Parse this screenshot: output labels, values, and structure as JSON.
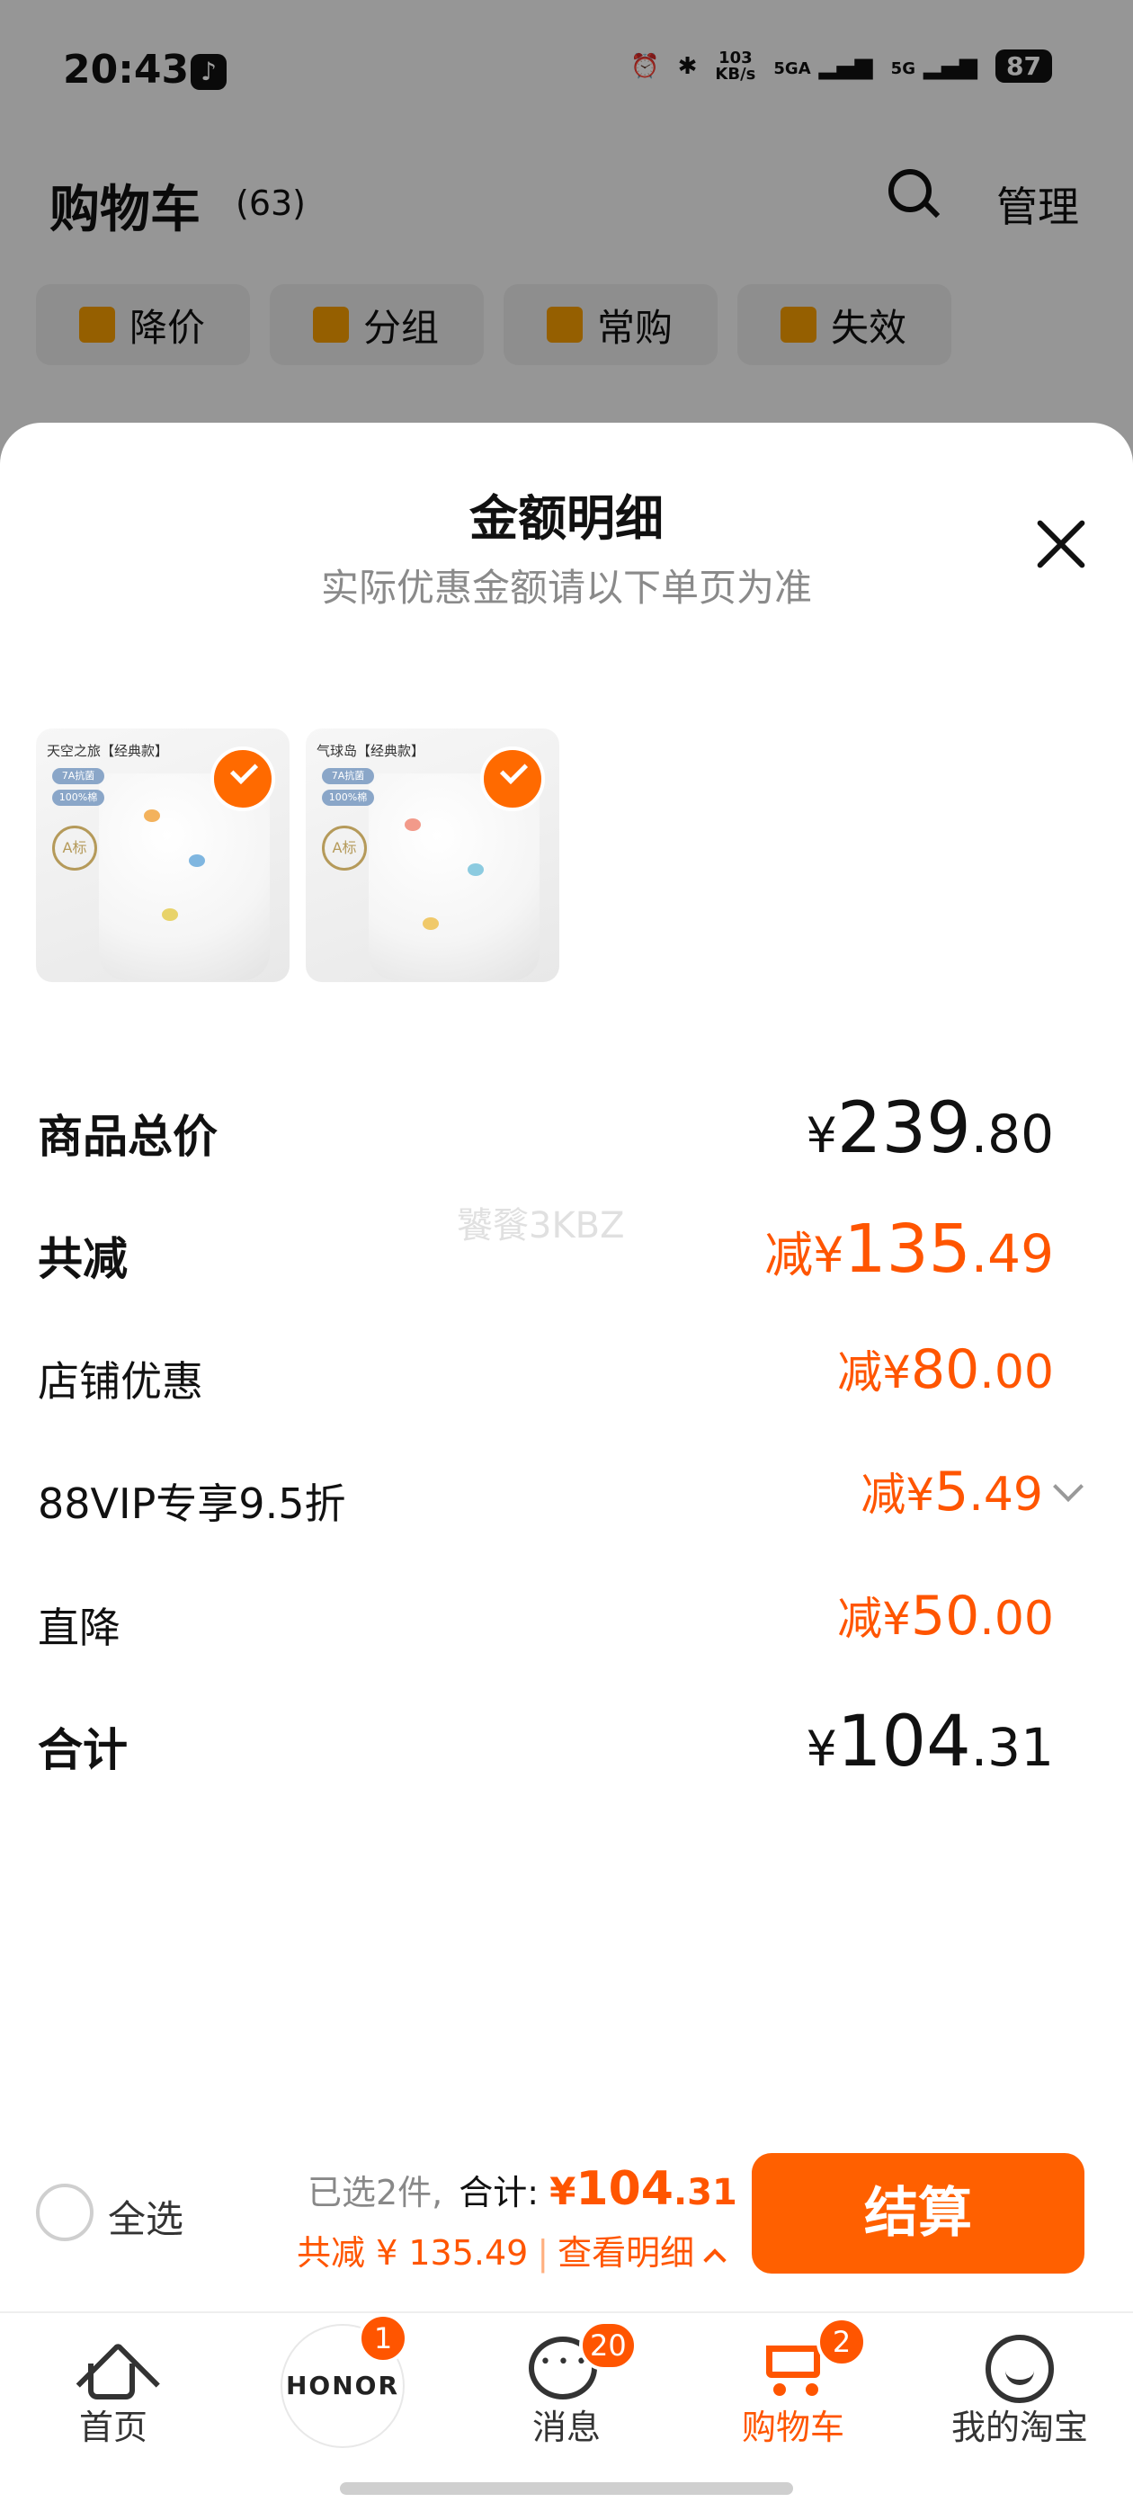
{
  "status_bar": {
    "time": "20:43",
    "net_speed_value": "103",
    "net_speed_unit": "KB/s",
    "sim1": "5GA",
    "sim2": "5G",
    "battery": "87"
  },
  "header": {
    "title": "购物车",
    "count": "(63)",
    "manage_label": "管理"
  },
  "chips": [
    {
      "label": "降价",
      "icon": "price-drop-icon"
    },
    {
      "label": "分组",
      "icon": "folder-icon"
    },
    {
      "label": "常购",
      "icon": "cart-icon"
    },
    {
      "label": "失效",
      "icon": "invalid-tag-icon"
    }
  ],
  "sheet": {
    "title": "金额明细",
    "subtitle": "实际优惠金额请以下单页为准",
    "products": [
      {
        "tag": "天空之旅【经典款】",
        "pill1": "7A抗菌",
        "pill2": "100%棉",
        "badge": "A标"
      },
      {
        "tag": "气球岛【经典款】",
        "pill1": "7A抗菌",
        "pill2": "100%棉",
        "badge": "A标"
      }
    ],
    "rows": {
      "total_label": "商品总价",
      "total_int": "239",
      "total_dec": ".80",
      "discount_label": "共减",
      "discount_prefix": "减¥",
      "discount_int": "135",
      "discount_dec": ".49",
      "shop_label": "店铺优惠",
      "shop_prefix": "减¥",
      "shop_int": "80",
      "shop_dec": ".00",
      "vip_label": "88VIP专享9.5折",
      "vip_prefix": "减¥",
      "vip_int": "5",
      "vip_dec": ".49",
      "direct_label": "直降",
      "direct_prefix": "减¥",
      "direct_int": "50",
      "direct_dec": ".00",
      "sum_label": "合计",
      "sum_int": "104",
      "sum_dec": ".31"
    },
    "currency": "¥",
    "watermark": "饕餮3KBZ"
  },
  "checkout": {
    "select_all": "全选",
    "selected_text": "已选2件,",
    "total_label": "合计:",
    "currency": "¥",
    "total_int": "104",
    "total_dec": ".31",
    "discount_text": "共减 ¥ 135.49",
    "separator": "|",
    "detail_link": "查看明细",
    "pay_button": "结算"
  },
  "tabbar": {
    "tabs": [
      {
        "label": "首页",
        "icon": "home-icon"
      },
      {
        "label": "HONOR",
        "icon": "honor-logo",
        "badge": "1"
      },
      {
        "label": "消息",
        "icon": "message-icon",
        "badge": "20"
      },
      {
        "label": "购物车",
        "icon": "cart-icon",
        "badge": "2",
        "active": true
      },
      {
        "label": "我的淘宝",
        "icon": "smile-icon"
      }
    ]
  },
  "colors": {
    "accent": "#ff5500",
    "button": "#ff6000"
  }
}
